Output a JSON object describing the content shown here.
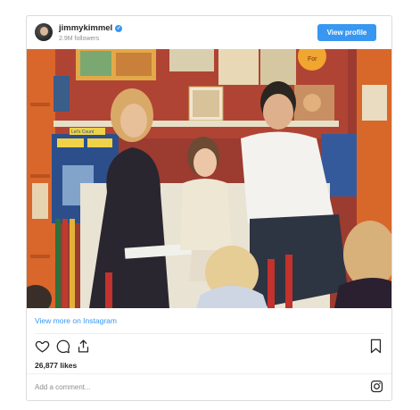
{
  "header": {
    "username": "jimmykimmel",
    "followers": "2.9M followers",
    "view_profile_label": "View profile"
  },
  "media": {
    "wall_signs": [
      "Let's Count",
      "For"
    ]
  },
  "footer": {
    "view_more_label": "View more on Instagram",
    "likes": "26,877 likes",
    "comment_placeholder": "Add a comment..."
  },
  "icons": {
    "verified": "verified-badge-icon",
    "like": "heart-icon",
    "comment": "comment-icon",
    "share": "share-icon",
    "save": "bookmark-icon",
    "instagram": "instagram-logo-icon"
  },
  "colors": {
    "accent": "#3897f0",
    "text": "#262626",
    "muted": "#8e8e8e",
    "border": "#dbdbdb"
  }
}
